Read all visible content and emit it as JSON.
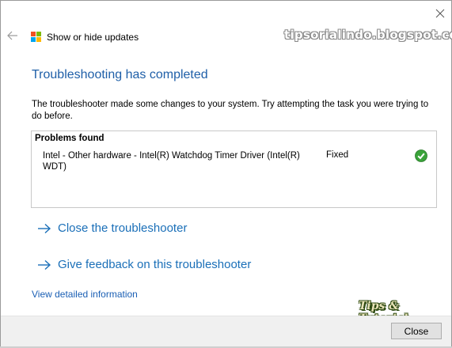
{
  "window": {
    "title": "Show or hide updates",
    "watermark": "tipsorialindo.blogspot.com"
  },
  "main": {
    "heading": "Troubleshooting has completed",
    "description": "The troubleshooter made some changes to your system. Try attempting the task you were trying to do before.",
    "problems": {
      "header": "Problems found",
      "items": [
        {
          "name": "Intel - Other hardware - Intel(R) Watchdog Timer Driver (Intel(R) WDT)",
          "status": "Fixed"
        }
      ]
    },
    "links": {
      "close_troubleshooter": "Close the troubleshooter",
      "give_feedback": "Give feedback on this troubleshooter",
      "view_details": "View detailed information"
    }
  },
  "branding": {
    "tips": "Tips & Tutorial"
  },
  "footer": {
    "close_label": "Close"
  },
  "colors": {
    "heading": "#1f5fa8",
    "link": "#1a6fb8",
    "check": "#3aa33a",
    "logo": [
      "#f25022",
      "#7fba00",
      "#00a4ef",
      "#ffb900"
    ]
  }
}
